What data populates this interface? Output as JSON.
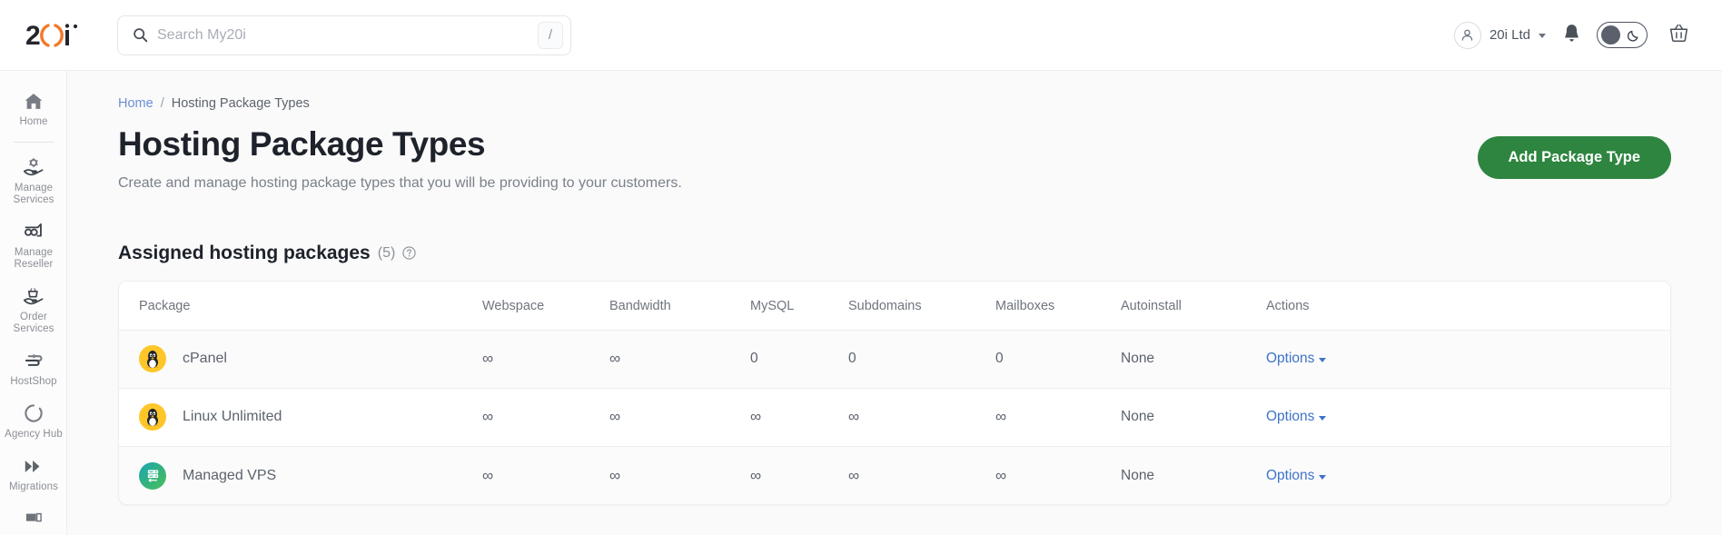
{
  "header": {
    "logo_text": "20i",
    "search": {
      "placeholder": "Search My20i",
      "value": "",
      "shortcut_key": "/"
    },
    "account_name": "20i Ltd",
    "icons": {
      "search": "search-icon",
      "user": "user-avatar-icon",
      "bell": "notification-bell-icon",
      "theme": "dark-mode-toggle",
      "basket": "shopping-basket-icon"
    }
  },
  "sidebar": {
    "items": [
      {
        "label": "Home",
        "icon": "home-icon"
      },
      {
        "label": "Manage Services",
        "icon": "manage-services-icon"
      },
      {
        "label": "Manage Reseller",
        "icon": "manage-reseller-icon"
      },
      {
        "label": "Order Services",
        "icon": "order-services-icon"
      },
      {
        "label": "HostShop",
        "icon": "hostshop-icon"
      },
      {
        "label": "Agency Hub",
        "icon": "agency-hub-icon"
      },
      {
        "label": "Migrations",
        "icon": "migrations-icon"
      }
    ]
  },
  "breadcrumb": {
    "home": "Home",
    "separator": "/",
    "current": "Hosting Package Types"
  },
  "page": {
    "title": "Hosting Package Types",
    "subtitle": "Create and manage hosting package types that you will be providing to your customers.",
    "add_button": "Add Package Type"
  },
  "section": {
    "title": "Assigned hosting packages",
    "count": "(5)",
    "help": "?"
  },
  "table": {
    "columns": [
      "Package",
      "Webspace",
      "Bandwidth",
      "MySQL",
      "Subdomains",
      "Mailboxes",
      "Autoinstall",
      "Actions"
    ],
    "rows": [
      {
        "package": "cPanel",
        "icon": "linux-tux-icon",
        "webspace": "∞",
        "bandwidth": "∞",
        "mysql": "0",
        "subdomains": "0",
        "mailboxes": "0",
        "autoinstall": "None",
        "action": "Options"
      },
      {
        "package": "Linux Unlimited",
        "icon": "linux-tux-icon",
        "webspace": "∞",
        "bandwidth": "∞",
        "mysql": "∞",
        "subdomains": "∞",
        "mailboxes": "∞",
        "autoinstall": "None",
        "action": "Options"
      },
      {
        "package": "Managed VPS",
        "icon": "server-vps-icon",
        "webspace": "∞",
        "bandwidth": "∞",
        "mysql": "∞",
        "subdomains": "∞",
        "mailboxes": "∞",
        "autoinstall": "None",
        "action": "Options"
      }
    ]
  },
  "colors": {
    "brand_orange": "#f2792b",
    "primary_green": "#2e8540",
    "link_blue": "#3e73c8",
    "breadcrumb_blue": "#6b8fd6",
    "tux_yellow": "#ffc629",
    "vps_teal": "#1aa6b7"
  }
}
